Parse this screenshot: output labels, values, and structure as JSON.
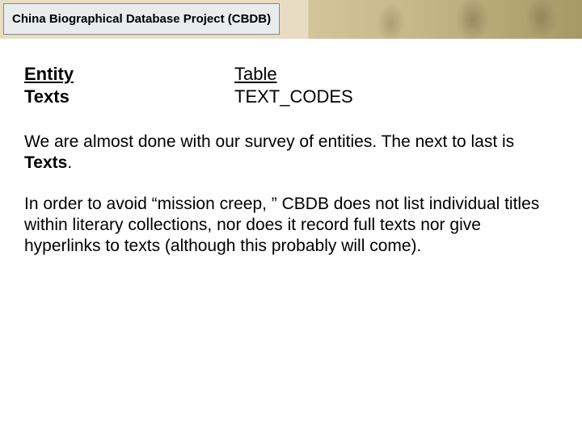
{
  "header": {
    "title": "China Biographical Database Project (CBDB)"
  },
  "headings": {
    "entity_label": "Entity",
    "entity_value": "Texts",
    "table_label": "Table",
    "table_value": "TEXT_CODES"
  },
  "paragraphs": {
    "p1_pre": "We are almost done with our survey of entities.  The next to last is ",
    "p1_bold": "Texts",
    "p1_post": ".",
    "p2": "In order to avoid “mission creep, ” CBDB does not list individual titles within literary collections, nor does it record full texts nor give hyperlinks to texts (although this probably will come)."
  }
}
